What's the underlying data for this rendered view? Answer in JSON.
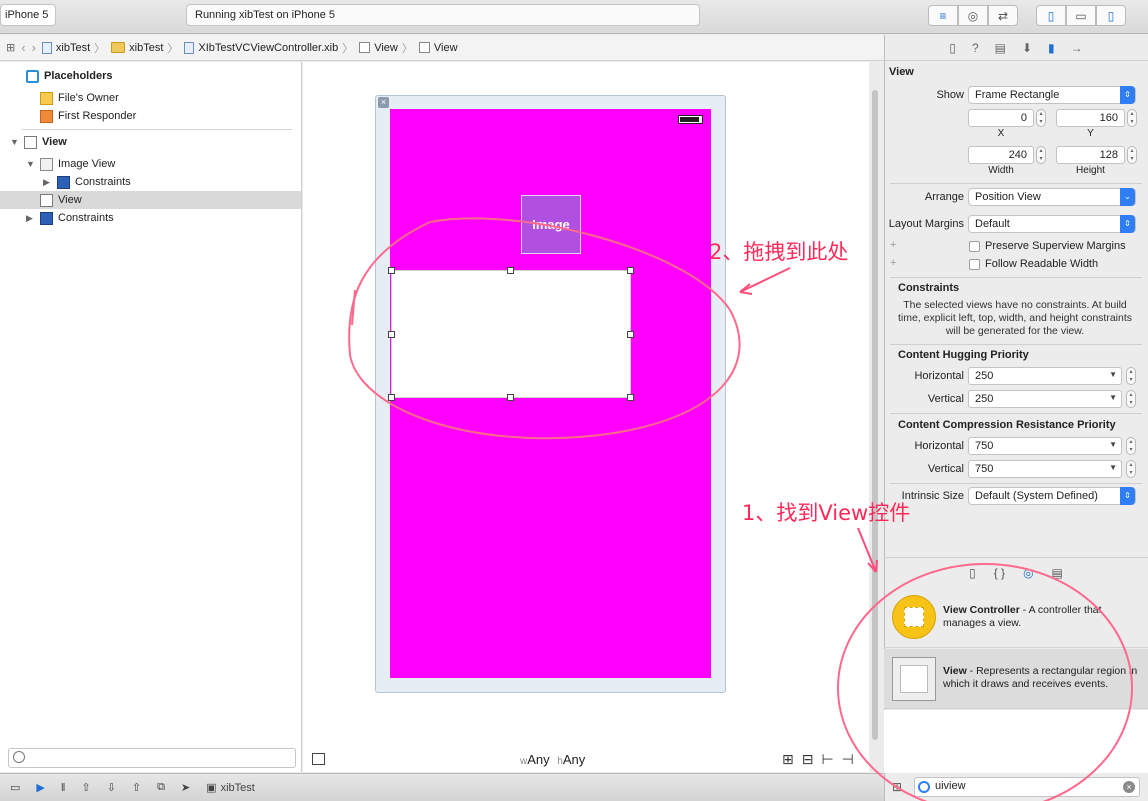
{
  "toolbar": {
    "scheme": "iPhone 5",
    "activity": "Running xibTest on iPhone 5"
  },
  "jumpbar": {
    "items": [
      "xibTest",
      "xibTest",
      "XIbTestVCViewController.xib",
      "View",
      "View"
    ]
  },
  "outline": {
    "placeholders": "Placeholders",
    "files_owner": "File's Owner",
    "first_responder": "First Responder",
    "view": "View",
    "image_view": "Image View",
    "constraints1": "Constraints",
    "subview": "View",
    "constraints2": "Constraints"
  },
  "canvas": {
    "image_label": "Image",
    "size_w_prefix": "w",
    "size_w": "Any",
    "size_h_prefix": "h",
    "size_h": "Any"
  },
  "debugbar": {
    "target": "xibTest"
  },
  "inspector": {
    "title": "View",
    "show_label": "Show",
    "show_value": "Frame Rectangle",
    "x_value": "0",
    "x_label": "X",
    "y_value": "160",
    "y_label": "Y",
    "width_value": "240",
    "width_label": "Width",
    "height_value": "128",
    "height_label": "Height",
    "arrange_label": "Arrange",
    "arrange_value": "Position View",
    "layout_margins_label": "Layout Margins",
    "layout_margins_value": "Default",
    "preserve_label": "Preserve Superview Margins",
    "follow_label": "Follow Readable Width",
    "constraints_title": "Constraints",
    "constraints_text": "The selected views have no constraints. At build time, explicit left, top, width, and height constraints will be generated for the view.",
    "hugging_title": "Content Hugging Priority",
    "hugging_h_label": "Horizontal",
    "hugging_h_value": "250",
    "hugging_v_label": "Vertical",
    "hugging_v_value": "250",
    "compression_title": "Content Compression Resistance Priority",
    "compression_h_label": "Horizontal",
    "compression_h_value": "750",
    "compression_v_label": "Vertical",
    "compression_v_value": "750",
    "intrinsic_label": "Intrinsic Size",
    "intrinsic_value": "Default (System Defined)"
  },
  "library": {
    "item1_title": "View Controller",
    "item1_desc": " - A controller that manages a view.",
    "item2_title": "View",
    "item2_desc": " - Represents a rectangular region in which it draws and receives events.",
    "search_value": "uiview"
  },
  "annotations": {
    "step1": "1、找到View控件",
    "step2": "2、拖拽到此处"
  },
  "colors": {
    "screen_bg": "#ff00ff",
    "image_bg": "#b14fe0",
    "annotation": "#ff2a5a",
    "accent": "#2f7ef5"
  }
}
